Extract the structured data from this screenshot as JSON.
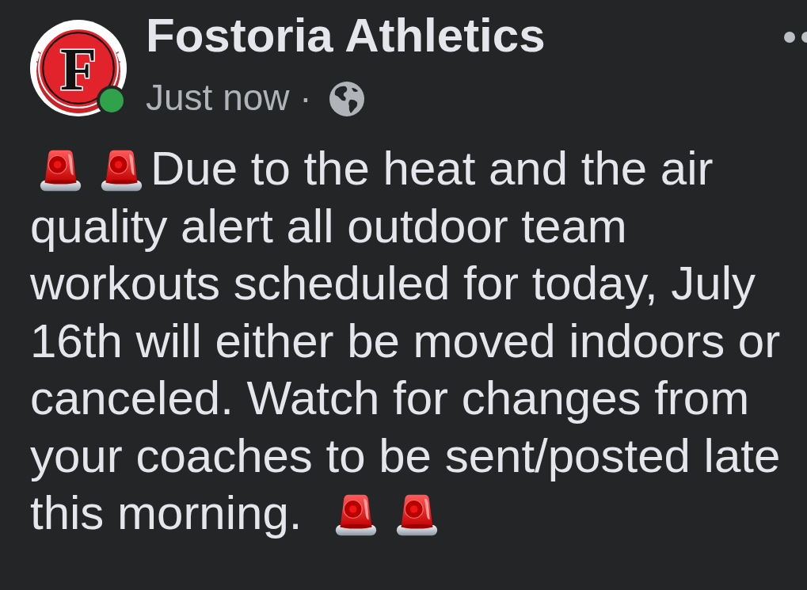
{
  "post": {
    "author": {
      "name": "Fostoria Athletics",
      "logo_letter": "F",
      "online": true
    },
    "time": "Just now ·",
    "message_lines": [
      "Due to the heat and the air",
      "quality alert all outdoor team",
      "workouts scheduled for today, July",
      "16th will either be moved indoors or",
      "canceled. Watch for changes from",
      "your coaches to be sent/posted late",
      "this morning."
    ]
  }
}
